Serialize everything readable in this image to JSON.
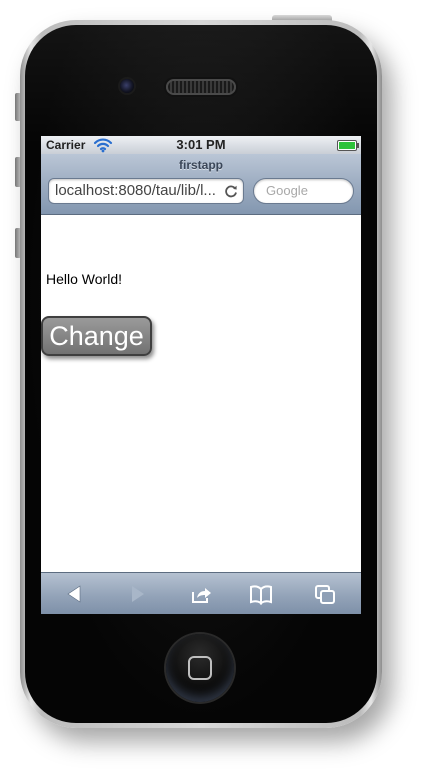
{
  "status_bar": {
    "carrier": "Carrier",
    "time": "3:01 PM",
    "battery_level": 1.0,
    "wifi_icon": "wifi-icon",
    "battery_icon": "battery-icon"
  },
  "browser": {
    "page_title": "firstapp",
    "url": "localhost:8080/tau/lib/l...",
    "search_placeholder": "Google",
    "reload_icon": "reload-icon"
  },
  "content": {
    "hello_text": "Hello World!",
    "change_button_label": "Change"
  },
  "toolbar": {
    "back_icon": "back-arrow-icon",
    "forward_icon": "forward-arrow-icon",
    "share_icon": "share-icon",
    "bookmarks_icon": "bookmarks-icon",
    "tabs_icon": "tabs-icon"
  },
  "colors": {
    "button_gray": "#808080",
    "battery_green": "#2ec23b",
    "nav_blue": "#9aaabf"
  }
}
